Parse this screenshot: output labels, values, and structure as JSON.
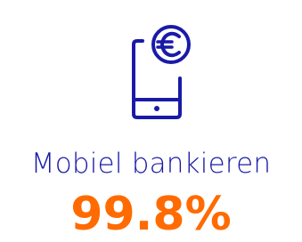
{
  "stat": {
    "icon": "mobile-euro-icon",
    "label": "Mobiel bankieren",
    "value": "99.8%"
  },
  "colors": {
    "primary": "#1a1aa8",
    "accent": "#ff6b00",
    "background": "#ffffff"
  }
}
